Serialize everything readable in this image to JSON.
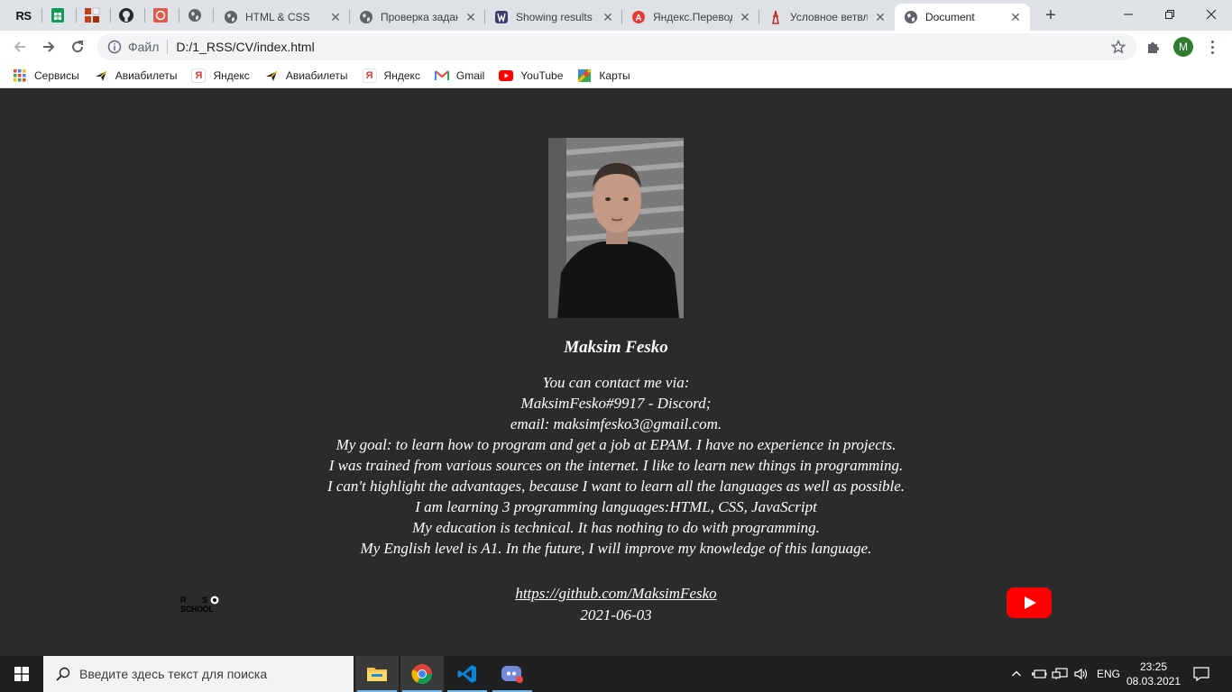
{
  "browser": {
    "pinned_tabs": [
      {
        "icon": "rs-school-icon",
        "label": "RS"
      },
      {
        "icon": "google-sheets-icon"
      },
      {
        "icon": "office-apps-icon"
      },
      {
        "icon": "github-icon"
      },
      {
        "icon": "codewars-icon"
      },
      {
        "icon": "globe-icon"
      }
    ],
    "tabs": [
      {
        "title": "HTML & CSS",
        "icon": "globe-icon"
      },
      {
        "title": "Проверка задан",
        "icon": "globe-icon"
      },
      {
        "title": "Showing results",
        "icon": "wolfram-icon"
      },
      {
        "title": "Яндекс.Перевод",
        "icon": "yandex-translate-icon"
      },
      {
        "title": "Условное ветвле",
        "icon": "javascript-info-icon"
      },
      {
        "title": "Document",
        "icon": "globe-icon",
        "active": true
      }
    ],
    "address": {
      "protocol_label": "Файл",
      "url": "D:/1_RSS/CV/index.html"
    },
    "profile_initial": "M",
    "bookmarks": [
      {
        "label": "Сервисы",
        "icon": "apps-grid-icon"
      },
      {
        "label": "Авиабилеты",
        "icon": "plane-icon"
      },
      {
        "label": "Яндекс",
        "icon": "yandex-icon"
      },
      {
        "label": "Авиабилеты",
        "icon": "plane-icon"
      },
      {
        "label": "Яндекс",
        "icon": "yandex-icon"
      },
      {
        "label": "Gmail",
        "icon": "gmail-icon"
      },
      {
        "label": "YouTube",
        "icon": "youtube-icon"
      },
      {
        "label": "Карты",
        "icon": "maps-icon"
      }
    ]
  },
  "cv": {
    "name": "Maksim Fesko",
    "lines": [
      "You can contact me via:",
      "MaksimFesko#9917 - Discord;",
      "email: maksimfesko3@gmail.com.",
      "My goal: to learn how to program and get a job at EPAM. I have no experience in projects.",
      "I was trained from various sources on the internet. I like to learn new things in programming.",
      "I can't highlight the advantages, because I want to learn all the languages as well as possible.",
      "I am learning 3 programming languages:HTML, CSS, JavaScript",
      "My education is technical. It has nothing to do with programming.",
      "My English level is A1. In the future, I will improve my knowledge of this language."
    ],
    "github_link": "https://github.com/MaksimFesko",
    "date": "2021-06-03",
    "rs_logo": {
      "top": "R S",
      "bottom": "SCHOOL"
    }
  },
  "taskbar": {
    "search_placeholder": "Введите здесь текст для поиска",
    "apps": [
      "file-explorer-icon",
      "chrome-icon",
      "vscode-icon",
      "discord-icon"
    ],
    "language": "ENG",
    "time": "23:25",
    "date": "08.03.2021"
  },
  "colors": {
    "page_background": "#2b2b2b",
    "text": "#ffffff",
    "tabstrip": "#dee1e6",
    "youtube_red": "#ff0000"
  }
}
